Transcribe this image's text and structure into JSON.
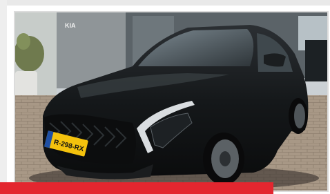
{
  "photo": {
    "description_icon": "car-photo",
    "dealer_sign_text": "KIA",
    "license_plate": "R-298-RX"
  },
  "colors": {
    "accent_bar": "#e3262f",
    "car_body": "#141617",
    "background_grey": "#e9e9e9"
  }
}
